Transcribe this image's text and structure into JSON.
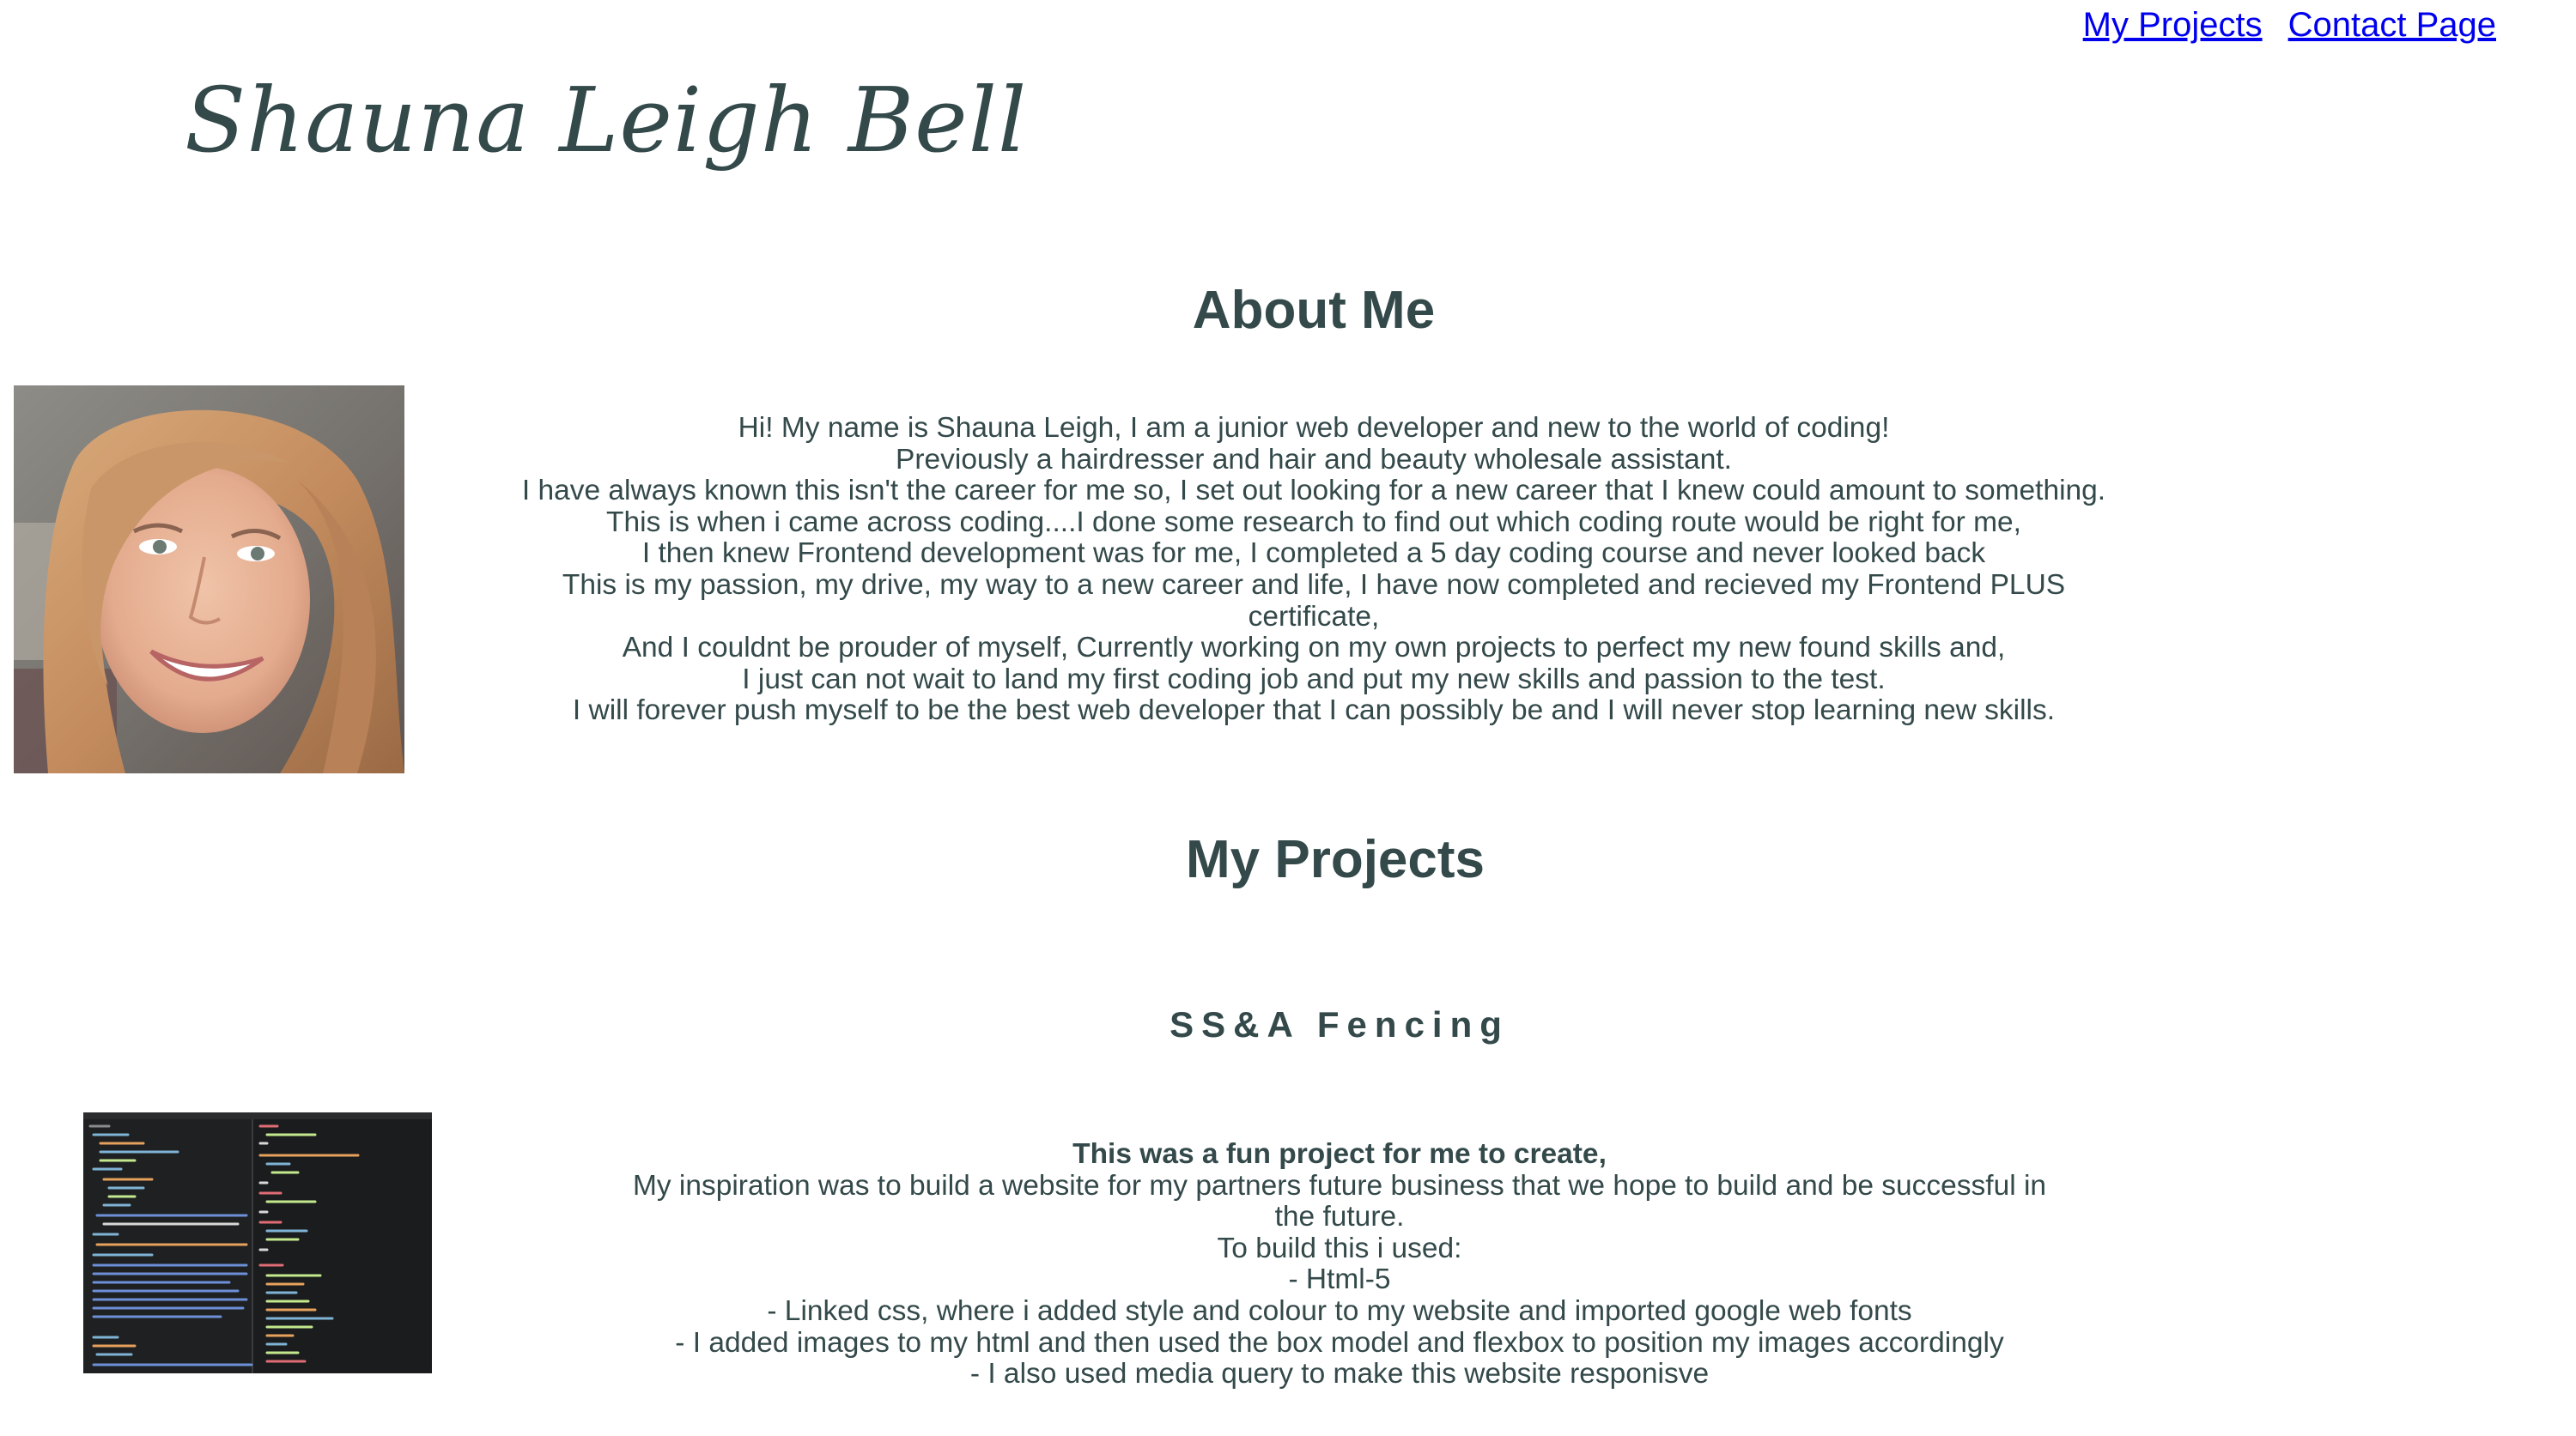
{
  "nav": {
    "projects_link": "My Projects",
    "contact_link": "Contact Page"
  },
  "site": {
    "title": "Shauna Leigh Bell"
  },
  "about": {
    "heading": "About Me",
    "lines": [
      "Hi! My name is Shauna Leigh, I am a junior web developer and new to the world of coding!",
      "Previously a hairdresser and hair and beauty wholesale assistant.",
      "I have always known this isn't the career for me so, I set out looking for a new career that I knew could amount to something.",
      "This is when i came across coding....I done some research to find out which coding route would be right for me,",
      "I then knew Frontend development was for me, I completed a 5 day coding course and never looked back",
      "This is my passion, my drive, my way to a new career and life, I have now completed and recieved my Frontend PLUS",
      "certificate,",
      "And I couldnt be prouder of myself, Currently working on my own projects to perfect my new found skills and,",
      "I just can not wait to land my first coding job and put my new skills and passion to the test.",
      "I will forever push myself to be the best web developer that I can possibly be and I will never stop learning new skills."
    ]
  },
  "projects": {
    "heading": "My Projects",
    "items": [
      {
        "title": "SS&A Fencing",
        "lead": "This was a fun project for me to create,",
        "lines": [
          "My inspiration was to build a website for my partners future business that we hope to build and be successful in",
          "the future.",
          "To build this i used:",
          "- Html-5",
          "- Linked css, where i added style and colour to my website and imported google web fonts",
          "- I added images to my html and then used the box model and flexbox to position my images accordingly",
          "- I also used media query to make this website responisve"
        ]
      }
    ]
  },
  "colors": {
    "text": "#34494a",
    "link": "#0000ee",
    "background": "#ffffff",
    "editor_bg": "#1b1c1d"
  }
}
